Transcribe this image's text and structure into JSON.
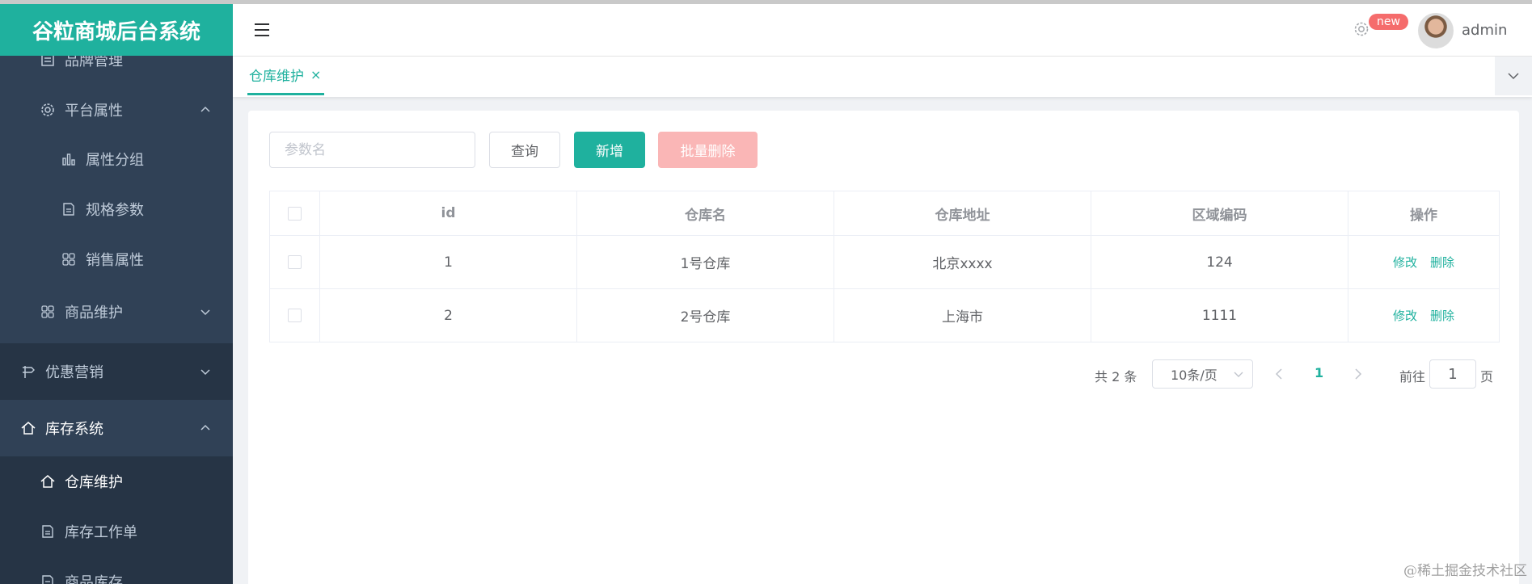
{
  "app": {
    "title": "谷粒商城后台系统"
  },
  "colors": {
    "accent": "#1fb19e",
    "sidebar_bg": "#304156",
    "danger_light": "#fab6b6",
    "badge": "#f56c6c"
  },
  "sidebar": {
    "items": [
      {
        "label": "品牌管理",
        "icon": "list-icon"
      },
      {
        "label": "平台属性",
        "icon": "gear-icon",
        "arrow": "up"
      },
      {
        "label": "属性分组",
        "icon": "bar-chart-icon"
      },
      {
        "label": "规格参数",
        "icon": "document-icon"
      },
      {
        "label": "销售属性",
        "icon": "grid-icon"
      },
      {
        "label": "商品维护",
        "icon": "grid-icon",
        "arrow": "down"
      },
      {
        "label": "优惠营销",
        "icon": "marketing-icon",
        "arrow": "down"
      },
      {
        "label": "库存系统",
        "icon": "home-icon",
        "arrow": "up"
      },
      {
        "label": "仓库维护",
        "icon": "home-icon",
        "active": true
      },
      {
        "label": "库存工作单",
        "icon": "document-icon"
      },
      {
        "label": "商品库存",
        "icon": "document-icon"
      }
    ]
  },
  "header": {
    "badge": "new",
    "username": "admin"
  },
  "tags": [
    {
      "label": "仓库维护",
      "close": "×"
    }
  ],
  "toolbar": {
    "search_placeholder": "参数名",
    "query_label": "查询",
    "add_label": "新增",
    "batch_delete_label": "批量删除"
  },
  "table": {
    "columns": [
      "id",
      "仓库名",
      "仓库地址",
      "区域编码",
      "操作"
    ],
    "rows": [
      {
        "id": "1",
        "name": "1号仓库",
        "address": "北京xxxx",
        "areacode": "124"
      },
      {
        "id": "2",
        "name": "2号仓库",
        "address": "上海市",
        "areacode": "1111"
      }
    ],
    "edit_label": "修改",
    "delete_label": "删除"
  },
  "pagination": {
    "total_text": "共 2 条",
    "page_size": "10条/页",
    "current_page": "1",
    "goto_label": "前往",
    "goto_value": "1",
    "page_unit": "页"
  },
  "watermark": "@稀土掘金技术社区"
}
